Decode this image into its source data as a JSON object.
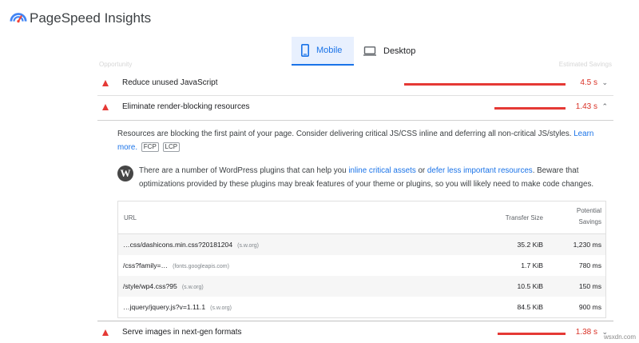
{
  "app": {
    "title": "PageSpeed Insights"
  },
  "tabs": [
    {
      "label": "Mobile",
      "active": true
    },
    {
      "label": "Desktop",
      "active": false
    }
  ],
  "section": {
    "left_header": "Opportunity",
    "right_header": "Estimated Savings"
  },
  "audits": [
    {
      "title": "Reduce unused JavaScript",
      "value": "4.5 s",
      "bar_fraction": 1.0,
      "expanded": false
    },
    {
      "title": "Eliminate render-blocking resources",
      "value": "1.43 s",
      "bar_fraction": 0.44,
      "expanded": true
    },
    {
      "title": "Serve images in next-gen formats",
      "value": "1.38 s",
      "bar_fraction": 0.42,
      "expanded": false
    }
  ],
  "details": {
    "desc_text": "Resources are blocking the first paint of your page. Consider delivering critical JS/CSS inline and deferring all non-critical JS/styles.",
    "learn_link_a": "Learn",
    "learn_link_b": "more.",
    "badges": [
      "FCP",
      "LCP"
    ],
    "wp_before": "There are a number of WordPress plugins that can help you",
    "wp_link1": "inline critical assets",
    "wp_or": "or",
    "wp_link2": "defer less important resources",
    "wp_after": ". Beware that optimizations provided by these plugins may break features of your theme or plugins, so you will likely need to make code changes.",
    "table": {
      "col_url": "URL",
      "col_size": "Transfer Size",
      "col_savings_1": "Potential",
      "col_savings_2": "Savings",
      "rows": [
        {
          "url": "…css/dashicons.min.css?20181204",
          "host": "(s.w.org)",
          "size": "35.2 KiB",
          "savings": "1,230 ms"
        },
        {
          "url": "/css?family=…",
          "host": "(fonts.googleapis.com)",
          "size": "1.7 KiB",
          "savings": "780 ms"
        },
        {
          "url": "/style/wp4.css?95",
          "host": "(s.w.org)",
          "size": "10.5 KiB",
          "savings": "150 ms"
        },
        {
          "url": "…jquery/jquery.js?v=1.11.1",
          "host": "(s.w.org)",
          "size": "84.5 KiB",
          "savings": "900 ms"
        }
      ]
    }
  },
  "watermark": "wsxdn.com",
  "colors": {
    "accent": "#1a73e8",
    "fail": "#e53935",
    "tab_bg": "#e8f0fe"
  }
}
